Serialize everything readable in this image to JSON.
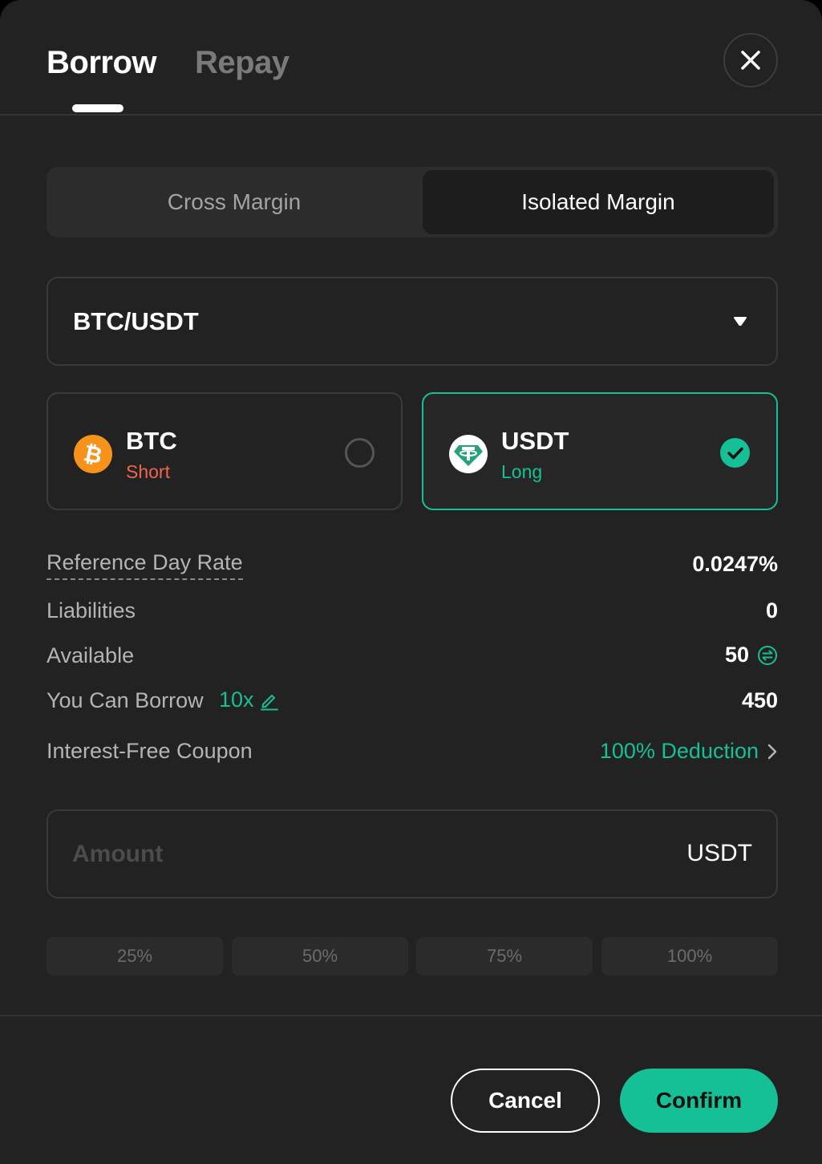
{
  "header": {
    "tabs": [
      {
        "label": "Borrow",
        "active": true
      },
      {
        "label": "Repay",
        "active": false
      }
    ]
  },
  "margin_mode": {
    "options": [
      {
        "label": "Cross Margin",
        "selected": false
      },
      {
        "label": "Isolated Margin",
        "selected": true
      }
    ]
  },
  "pair": {
    "value": "BTC/USDT"
  },
  "coins": [
    {
      "name": "BTC",
      "side": "Short",
      "selected": false,
      "icon": "bitcoin-icon",
      "color": "#f7931a"
    },
    {
      "name": "USDT",
      "side": "Long",
      "selected": true,
      "icon": "tether-icon",
      "color": "#26a17b"
    }
  ],
  "info": {
    "reference_day_rate_label": "Reference Day Rate",
    "reference_day_rate_value": "0.0247%",
    "liabilities_label": "Liabilities",
    "liabilities_value": "0",
    "available_label": "Available",
    "available_value": "50",
    "you_can_borrow_label": "You Can Borrow",
    "leverage": "10x",
    "you_can_borrow_value": "450",
    "coupon_label": "Interest-Free Coupon",
    "coupon_value": "100% Deduction"
  },
  "amount": {
    "placeholder": "Amount",
    "unit": "USDT"
  },
  "percentages": [
    "25%",
    "50%",
    "75%",
    "100%"
  ],
  "footer": {
    "cancel_label": "Cancel",
    "confirm_label": "Confirm"
  },
  "colors": {
    "accent": "#16c096",
    "short": "#f0654b",
    "background": "#222222"
  }
}
